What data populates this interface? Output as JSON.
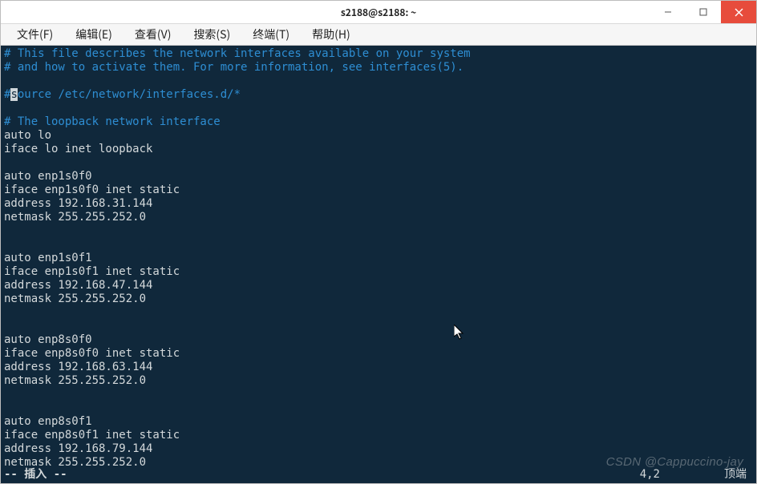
{
  "window": {
    "title": "s2188@s2188: ~"
  },
  "menu": {
    "file": "文件(F)",
    "edit": "编辑(E)",
    "view": "查看(V)",
    "search": "搜索(S)",
    "terminal": "终端(T)",
    "help": "帮助(H)"
  },
  "editor": {
    "comment_line1": "# This file describes the network interfaces available on your system",
    "comment_line2": "# and how to activate them. For more information, see interfaces(5).",
    "source_hash": "#",
    "source_cursor": "s",
    "source_rest": "ource /etc/network/interfaces.d/*",
    "loopback_comment": "# The loopback network interface",
    "lo_auto": "auto lo",
    "lo_iface": "iface lo inet loopback",
    "if1_auto": "auto enp1s0f0",
    "if1_iface": "iface enp1s0f0 inet static",
    "if1_address": "address 192.168.31.144",
    "if1_netmask": "netmask 255.255.252.0",
    "if2_auto": "auto enp1s0f1",
    "if2_iface": "iface enp1s0f1 inet static",
    "if2_address": "address 192.168.47.144",
    "if2_netmask": "netmask 255.255.252.0",
    "if3_auto": "auto enp8s0f0",
    "if3_iface": "iface enp8s0f0 inet static",
    "if3_address": "address 192.168.63.144",
    "if3_netmask": "netmask 255.255.252.0",
    "if4_auto": "auto enp8s0f1",
    "if4_iface": "iface enp8s0f1 inet static",
    "if4_address": "address 192.168.79.144",
    "if4_netmask": "netmask 255.255.252.0"
  },
  "status": {
    "mode": "-- 插入 --",
    "position": "4,2",
    "percent": "顶端"
  },
  "watermark": "CSDN @Cappuccino-jay"
}
